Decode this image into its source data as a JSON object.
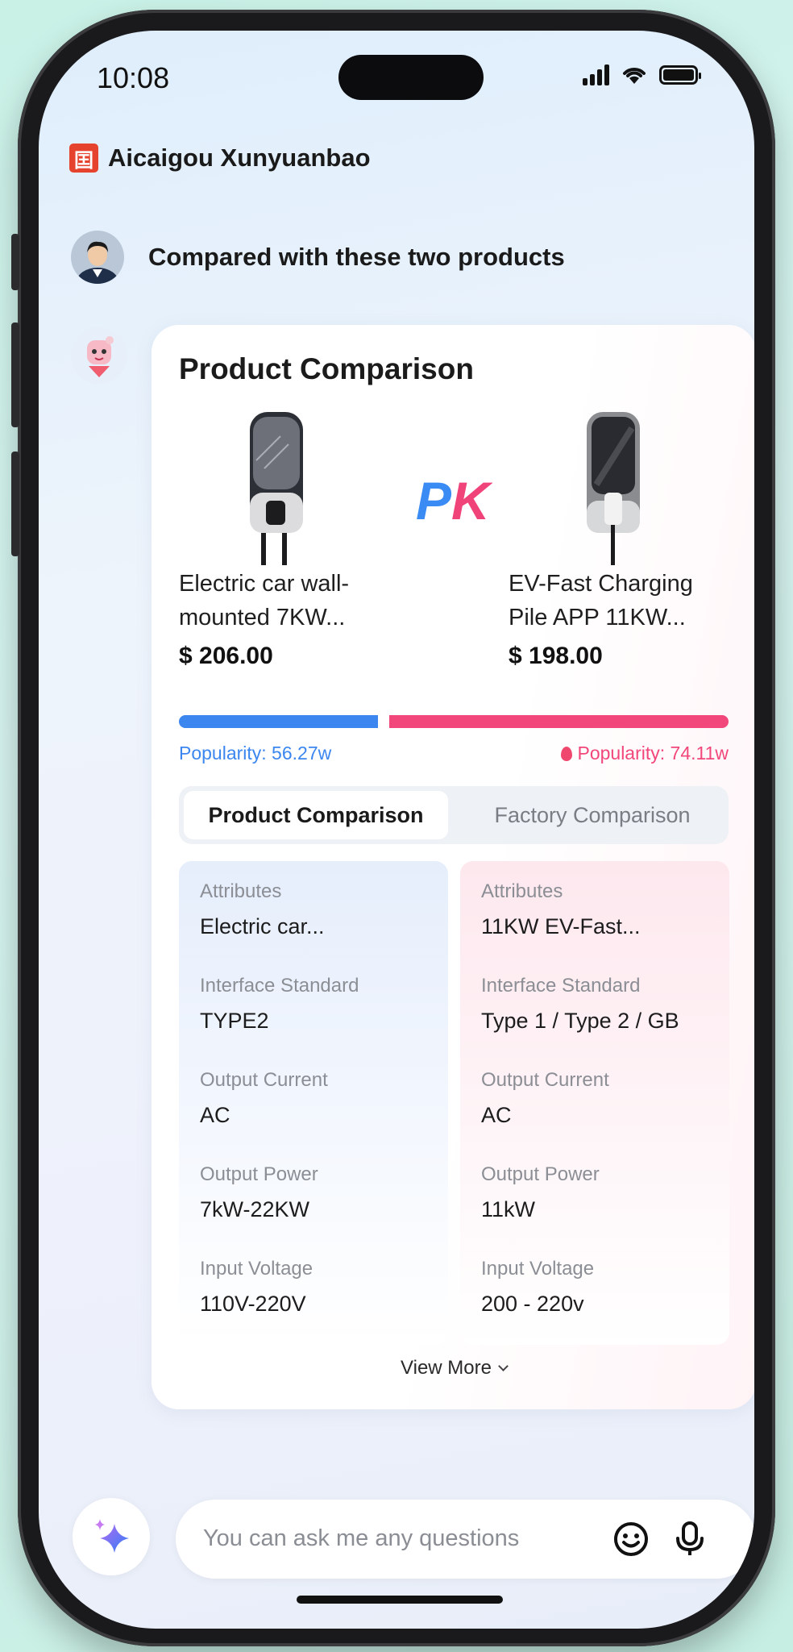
{
  "status_bar": {
    "time": "10:08"
  },
  "app": {
    "title": "Aicaigou Xunyuanbao",
    "logo_glyph": "囯"
  },
  "user_message": "Compared with these two products",
  "card": {
    "title": "Product Comparison",
    "pk": {
      "p": "P",
      "k": "K"
    },
    "products": [
      {
        "name_line1": "Electric car wall-",
        "name_line2": "mounted 7KW...",
        "price": "$ 206.00",
        "popularity": "Popularity: 56.27w",
        "color": "#3b86ef"
      },
      {
        "name_line1": "EV-Fast Charging",
        "name_line2": "Pile  APP 11KW...",
        "price": "$ 198.00",
        "popularity": "Popularity: 74.11w",
        "color": "#f1477b"
      }
    ],
    "popularity_share": {
      "left": 0.37,
      "right": 0.63
    },
    "tabs": {
      "product": "Product Comparison",
      "factory": "Factory Comparison"
    },
    "left_attrs": [
      {
        "label": "Attributes",
        "value": "Electric car..."
      },
      {
        "label": "Interface Standard",
        "value": "TYPE2"
      },
      {
        "label": "Output Current",
        "value": "AC"
      },
      {
        "label": "Output Power",
        "value": "7kW-22KW"
      },
      {
        "label": "Input Voltage",
        "value": "110V-220V"
      }
    ],
    "right_attrs": [
      {
        "label": "Attributes",
        "value": "11KW EV-Fast..."
      },
      {
        "label": "Interface Standard",
        "value": "Type 1 / Type 2 / GB"
      },
      {
        "label": "Output Current",
        "value": "AC"
      },
      {
        "label": "Output Power",
        "value": "11kW"
      },
      {
        "label": "Input Voltage",
        "value": "200 - 220v"
      }
    ],
    "view_more": "View More"
  },
  "input": {
    "placeholder": "You can ask me any questions"
  },
  "icons": {
    "magic": "sparkle-icon",
    "emoji": "smiley-icon",
    "mic": "microphone-icon",
    "flame": "flame-icon"
  }
}
